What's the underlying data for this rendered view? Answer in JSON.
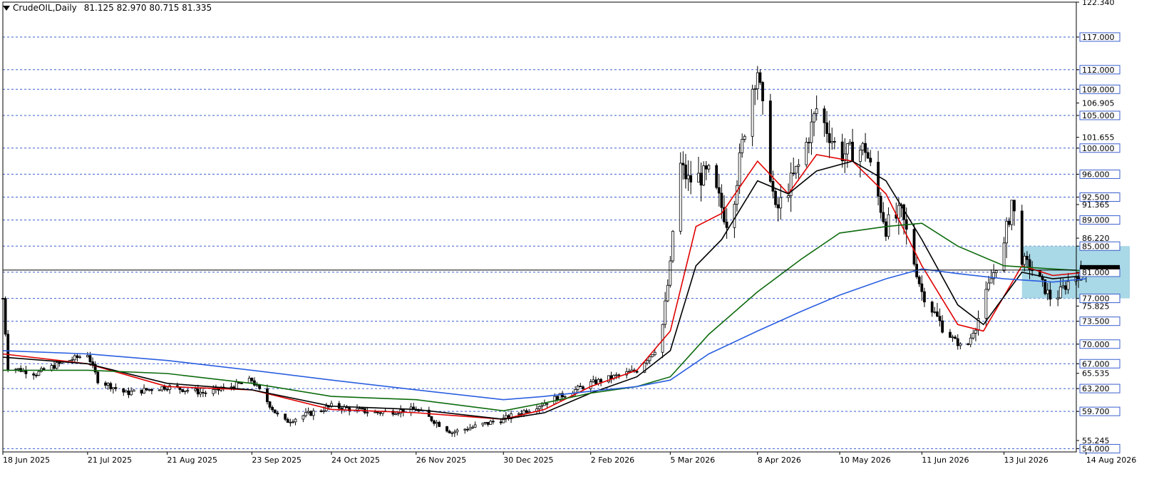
{
  "header": {
    "symbol_tf": "CrudeOIL,Daily",
    "ohlc": "81.125 82.970 80.715 81.335"
  },
  "colors": {
    "grid": "#3a5fcd",
    "candle": "#000000",
    "ma_fast": "#e00000",
    "ma_mid": "#000000",
    "ma_slow_green": "#0d6b0d",
    "ma_slow_blue": "#2b5fe0",
    "zone": "#a9d8e6"
  },
  "chart_data": {
    "type": "candlestick",
    "ylim": [
      53.5,
      122.34
    ],
    "grid": true,
    "dashed_levels": [
      117.0,
      112.0,
      109.0,
      105.0,
      100.0,
      96.0,
      92.5,
      89.0,
      85.0,
      81.0,
      77.0,
      73.5,
      70.0,
      67.0,
      63.2,
      59.7,
      54.0
    ],
    "y_tick_labels": [
      "122.340",
      "117.000",
      "112.000",
      "109.000",
      "106.905",
      "105.000",
      "101.655",
      "100.000",
      "96.000",
      "92.500",
      "91.365",
      "89.000",
      "86.220",
      "85.000",
      "81.000",
      "77.000",
      "75.825",
      "73.500",
      "70.000",
      "67.000",
      "65.535",
      "63.200",
      "59.700",
      "55.245",
      "54.000"
    ],
    "x_tick_labels": [
      "18 Jun 2025",
      "21 Jul 2025",
      "21 Aug 2025",
      "23 Sep 2025",
      "24 Oct 2025",
      "26 Nov 2025",
      "30 Dec 2025",
      "2 Feb 2026",
      "5 Mar 2026",
      "8 Apr 2026",
      "10 May 2026",
      "11 Jun 2026",
      "13 Jul 2026",
      "14 Aug 2026"
    ],
    "x_tick_dates": [
      "2025-06-18",
      "2025-07-21",
      "2025-08-21",
      "2025-09-23",
      "2025-10-24",
      "2025-11-26",
      "2025-12-30",
      "2026-02-02",
      "2026-03-05",
      "2026-04-08",
      "2026-05-10",
      "2026-06-11",
      "2026-07-13",
      "2026-08-14"
    ],
    "current_price": 81.335,
    "zone": {
      "date_from": "2026-07-20",
      "date_to": "2026-08-31",
      "y_from": 77.0,
      "y_to": 85.0
    },
    "price_path": [
      [
        "2025-06-18",
        77.0
      ],
      [
        "2025-06-20",
        66.5
      ],
      [
        "2025-07-01",
        65.5
      ],
      [
        "2025-07-10",
        67.0
      ],
      [
        "2025-07-21",
        68.5
      ],
      [
        "2025-07-25",
        64.5
      ],
      [
        "2025-08-05",
        62.5
      ],
      [
        "2025-08-21",
        63.5
      ],
      [
        "2025-09-05",
        62.5
      ],
      [
        "2025-09-15",
        63.5
      ],
      [
        "2025-09-23",
        64.5
      ],
      [
        "2025-10-05",
        58.0
      ],
      [
        "2025-10-24",
        60.5
      ],
      [
        "2025-11-10",
        59.5
      ],
      [
        "2025-11-26",
        60.0
      ],
      [
        "2025-12-10",
        56.5
      ],
      [
        "2025-12-30",
        58.5
      ],
      [
        "2026-01-15",
        61.0
      ],
      [
        "2026-02-02",
        64.0
      ],
      [
        "2026-02-20",
        66.0
      ],
      [
        "2026-03-01",
        70.0
      ],
      [
        "2026-03-05",
        82.0
      ],
      [
        "2026-03-08",
        98.0
      ],
      [
        "2026-03-12",
        95.0
      ],
      [
        "2026-03-20",
        96.0
      ],
      [
        "2026-03-28",
        88.0
      ],
      [
        "2026-04-05",
        108.0
      ],
      [
        "2026-04-08",
        112.0
      ],
      [
        "2026-04-15",
        90.0
      ],
      [
        "2026-04-25",
        98.0
      ],
      [
        "2026-05-01",
        106.0
      ],
      [
        "2026-05-10",
        99.0
      ],
      [
        "2026-05-20",
        100.0
      ],
      [
        "2026-05-28",
        88.0
      ],
      [
        "2026-06-03",
        90.0
      ],
      [
        "2026-06-11",
        78.0
      ],
      [
        "2026-06-20",
        72.0
      ],
      [
        "2026-06-28",
        69.0
      ],
      [
        "2026-07-03",
        74.0
      ],
      [
        "2026-07-08",
        80.0
      ],
      [
        "2026-07-13",
        85.0
      ],
      [
        "2026-07-16",
        92.0
      ],
      [
        "2026-07-20",
        83.0
      ],
      [
        "2026-07-25",
        81.0
      ],
      [
        "2026-08-01",
        76.5
      ],
      [
        "2026-08-08",
        80.0
      ],
      [
        "2026-08-14",
        81.335
      ]
    ],
    "series": [
      {
        "values": [
          [
            "2025-06-18",
            68.5
          ],
          [
            "2025-07-21",
            67.0
          ],
          [
            "2025-08-21",
            63.5
          ],
          [
            "2025-09-23",
            63.0
          ],
          [
            "2025-10-24",
            60.0
          ],
          [
            "2025-11-26",
            59.5
          ],
          [
            "2025-12-30",
            58.5
          ],
          [
            "2026-01-15",
            60.0
          ],
          [
            "2026-02-02",
            63.5
          ],
          [
            "2026-02-20",
            66.0
          ],
          [
            "2026-03-05",
            72.0
          ],
          [
            "2026-03-15",
            88.0
          ],
          [
            "2026-03-25",
            90.0
          ],
          [
            "2026-04-08",
            98.0
          ],
          [
            "2026-04-20",
            93.0
          ],
          [
            "2026-05-01",
            99.0
          ],
          [
            "2026-05-15",
            98.0
          ],
          [
            "2026-05-28",
            93.0
          ],
          [
            "2026-06-11",
            82.0
          ],
          [
            "2026-06-25",
            73.0
          ],
          [
            "2026-07-05",
            72.0
          ],
          [
            "2026-07-20",
            82.0
          ],
          [
            "2026-08-01",
            80.5
          ],
          [
            "2026-08-14",
            81.0
          ]
        ]
      },
      {
        "values": [
          [
            "2025-06-18",
            68.0
          ],
          [
            "2025-07-21",
            67.0
          ],
          [
            "2025-08-21",
            64.0
          ],
          [
            "2025-09-23",
            63.0
          ],
          [
            "2025-10-24",
            60.5
          ],
          [
            "2025-11-26",
            60.0
          ],
          [
            "2025-12-30",
            58.5
          ],
          [
            "2026-01-15",
            59.5
          ],
          [
            "2026-02-02",
            62.5
          ],
          [
            "2026-02-20",
            65.0
          ],
          [
            "2026-03-05",
            69.0
          ],
          [
            "2026-03-15",
            82.0
          ],
          [
            "2026-03-25",
            86.0
          ],
          [
            "2026-04-08",
            95.0
          ],
          [
            "2026-04-20",
            93.0
          ],
          [
            "2026-05-01",
            96.5
          ],
          [
            "2026-05-15",
            98.0
          ],
          [
            "2026-05-28",
            95.0
          ],
          [
            "2026-06-11",
            86.0
          ],
          [
            "2026-06-25",
            76.0
          ],
          [
            "2026-07-05",
            73.0
          ],
          [
            "2026-07-20",
            81.0
          ],
          [
            "2026-08-01",
            80.0
          ],
          [
            "2026-08-14",
            80.5
          ]
        ]
      },
      {
        "values": [
          [
            "2025-06-18",
            66.0
          ],
          [
            "2025-07-21",
            66.0
          ],
          [
            "2025-08-21",
            65.5
          ],
          [
            "2025-09-23",
            64.0
          ],
          [
            "2025-10-24",
            62.0
          ],
          [
            "2025-11-26",
            61.5
          ],
          [
            "2025-12-30",
            59.8
          ],
          [
            "2026-01-15",
            61.0
          ],
          [
            "2026-02-02",
            62.5
          ],
          [
            "2026-02-20",
            63.5
          ],
          [
            "2026-03-05",
            65.0
          ],
          [
            "2026-03-20",
            71.5
          ],
          [
            "2026-04-08",
            78.0
          ],
          [
            "2026-04-25",
            83.0
          ],
          [
            "2026-05-10",
            87.0
          ],
          [
            "2026-05-28",
            88.0
          ],
          [
            "2026-06-11",
            88.5
          ],
          [
            "2026-06-25",
            85.0
          ],
          [
            "2026-07-13",
            82.0
          ],
          [
            "2026-08-01",
            81.5
          ],
          [
            "2026-08-14",
            81.2
          ]
        ]
      },
      {
        "values": [
          [
            "2025-06-18",
            69.0
          ],
          [
            "2025-07-21",
            68.5
          ],
          [
            "2025-08-21",
            67.5
          ],
          [
            "2025-09-23",
            66.0
          ],
          [
            "2025-10-24",
            64.5
          ],
          [
            "2025-11-26",
            63.0
          ],
          [
            "2025-12-30",
            61.5
          ],
          [
            "2026-01-15",
            62.0
          ],
          [
            "2026-02-02",
            62.8
          ],
          [
            "2026-02-20",
            63.5
          ],
          [
            "2026-03-05",
            64.5
          ],
          [
            "2026-03-20",
            68.5
          ],
          [
            "2026-04-08",
            72.0
          ],
          [
            "2026-04-25",
            75.0
          ],
          [
            "2026-05-10",
            77.5
          ],
          [
            "2026-05-28",
            80.0
          ],
          [
            "2026-06-11",
            81.5
          ],
          [
            "2026-06-25",
            80.8
          ],
          [
            "2026-07-13",
            80.0
          ],
          [
            "2026-08-01",
            79.5
          ],
          [
            "2026-08-14",
            80.0
          ]
        ]
      }
    ]
  }
}
